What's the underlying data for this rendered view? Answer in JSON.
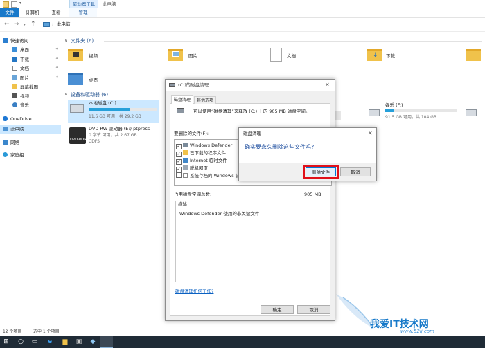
{
  "titlebar": {
    "context_tab": "驱动器工具",
    "window_title": "此电脑"
  },
  "ribbon": {
    "tabs": [
      "文件",
      "计算机",
      "查看"
    ],
    "context_tab_label": "管理"
  },
  "address": {
    "path": "此电脑"
  },
  "sidebar": {
    "items": [
      {
        "label": "快速访问",
        "icon": "star-icon"
      },
      {
        "label": "桌面",
        "icon": "desktop-icon"
      },
      {
        "label": "下载",
        "icon": "download-icon"
      },
      {
        "label": "文档",
        "icon": "documents-icon"
      },
      {
        "label": "图片",
        "icon": "pictures-icon"
      },
      {
        "label": "屏幕截图",
        "icon": "folder-icon"
      },
      {
        "label": "视频",
        "icon": "video-icon"
      },
      {
        "label": "音乐",
        "icon": "music-icon"
      },
      {
        "label": "OneDrive",
        "icon": "cloud-icon"
      },
      {
        "label": "此电脑",
        "icon": "computer-icon"
      },
      {
        "label": "网络",
        "icon": "network-icon"
      },
      {
        "label": "家庭组",
        "icon": "homegroup-icon"
      }
    ]
  },
  "folders_section": {
    "header": "文件夹 (6)",
    "items": [
      "视频",
      "图片",
      "文档",
      "下载",
      "桌面"
    ]
  },
  "drives_section": {
    "header": "设备和驱动器 (6)",
    "drive_c": {
      "name": "本地磁盘 (C:)",
      "free": "11.6 GB 可用，共 29.2 GB",
      "used_fraction": 0.6
    },
    "drive_dvd": {
      "name": "DVD RW 驱动器 (E:) ptpress",
      "free": "0 字节 可用，共 2.67 GB",
      "fs": "CDFS"
    },
    "drive_f": {
      "name": "娱乐 (F:)",
      "free": "91.5 GB 可用，共 104 GB",
      "used_fraction": 0.12
    }
  },
  "status": {
    "count": "12 个项目",
    "selected": "选中 1 个项目"
  },
  "cleanup_dialog": {
    "title": "(C:)的磁盘清理",
    "tab1": "磁盘清理",
    "tab2": "其他选项",
    "intro": "可以使用“磁盘清理”来释放 (C:) 上的 905 MB 磁盘空间。",
    "list_label": "要删除的文件(F):",
    "files": [
      {
        "label": "Windows Defender"
      },
      {
        "label": "已下载的程序文件"
      },
      {
        "label": "Internet 临时文件"
      },
      {
        "label": "脱机网页"
      },
      {
        "label": "系统存档的 Windows 错"
      }
    ],
    "total_label": "占用磁盘空间总数:",
    "total_value": "905 MB",
    "desc_label": "描述",
    "desc_text": "Windows Defender 使用的非关键文件",
    "help_link": "磁盘清理如何工作?",
    "ok": "确定",
    "cancel": "取消"
  },
  "confirm_dialog": {
    "title": "磁盘清理",
    "message": "确实要永久删除这些文件吗?",
    "delete_button": "删除文件",
    "cancel_button": "取消"
  },
  "watermark": {
    "text": "我爱IT技术网",
    "url": "www.52ij.com"
  },
  "colors": {
    "accent": "#1979ca",
    "highlight_border": "#e0111b",
    "drive_bar": "#26a0da"
  }
}
